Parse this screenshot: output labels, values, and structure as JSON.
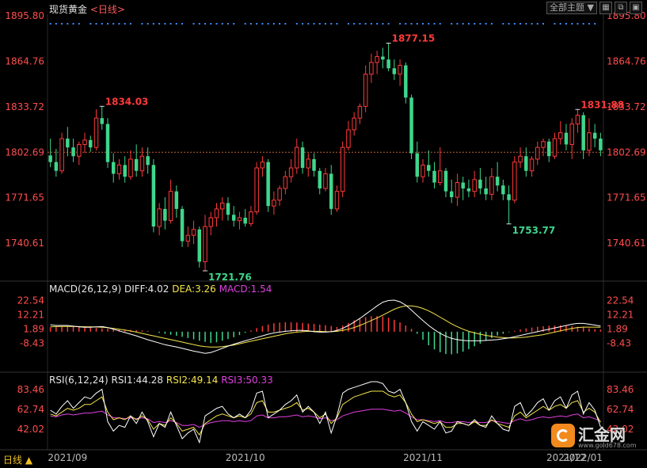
{
  "header": {
    "symbol": "现货黄金",
    "period_link": "<日线>",
    "toolbar_theme": "全部主题",
    "toolbar_arrow": "▼",
    "toolbar_icons": [
      "window-icon",
      "restore-icon",
      "maximize-icon"
    ]
  },
  "price_axis_labels": [
    "1895.80",
    "1864.76",
    "1833.72",
    "1802.69",
    "1771.65",
    "1740.61"
  ],
  "macd": {
    "title": "MACD(26,12,9)",
    "diff_label": "DIFF:4.02",
    "dea_label": "DEA:3.26",
    "macd_label": "MACD:1.54",
    "axis_labels": [
      "22.54",
      "12.21",
      "1.89",
      "-8.43"
    ]
  },
  "rsi": {
    "title": "RSI(6,12,24)",
    "rsi1_label": "RSI1:44.28",
    "rsi2_label": "RSI2:49.14",
    "rsi3_label": "RSI3:50.33",
    "axis_labels": [
      "83.46",
      "62.74",
      "42.02"
    ]
  },
  "date_labels": [
    "2021/09",
    "2021/10",
    "2021/11",
    "2021/12",
    "2022/01"
  ],
  "period_button": "日线 ▲",
  "watermark": {
    "name": "汇金网",
    "url": "www.gold678.com"
  },
  "colors": {
    "up": "#ff3a3a",
    "down": "#3fd68c",
    "price_axis": "#ff4d4d",
    "diff": "#ffffff",
    "dea": "#f5e64a",
    "macd_pos": "#ff3a3a",
    "macd_neg": "#3fd68c",
    "rsi1": "#ffffff",
    "rsi2": "#f5e64a",
    "rsi3": "#e040e0",
    "event_dots": "#3a8cff"
  },
  "chart_data": {
    "type": "candlestick",
    "title": "现货黄金 日线",
    "ylim": [
      1725,
      1895.8
    ],
    "reference_line": 1802.69,
    "annotations": [
      {
        "label": "1834.03",
        "type": "high"
      },
      {
        "label": "1721.76",
        "type": "low"
      },
      {
        "label": "1877.15",
        "type": "high"
      },
      {
        "label": "1753.77",
        "type": "low"
      },
      {
        "label": "1831.88",
        "type": "high"
      }
    ],
    "candles": [
      [
        1800.5,
        1812.0,
        1792.5,
        1796.0
      ],
      [
        1796.0,
        1805.0,
        1786.0,
        1790.0
      ],
      [
        1790.0,
        1816.0,
        1788.0,
        1812.0
      ],
      [
        1812.0,
        1820.0,
        1800.0,
        1806.0
      ],
      [
        1806.0,
        1812.0,
        1796.0,
        1800.0
      ],
      [
        1800.0,
        1810.0,
        1794.0,
        1808.0
      ],
      [
        1808.0,
        1816.0,
        1802.0,
        1811.0
      ],
      [
        1811.0,
        1814.0,
        1803.0,
        1806.0
      ],
      [
        1806.0,
        1832.0,
        1804.0,
        1826.0
      ],
      [
        1826.0,
        1834.03,
        1818.0,
        1822.0
      ],
      [
        1822.0,
        1826.0,
        1792.0,
        1796.0
      ],
      [
        1796.0,
        1802.0,
        1782.0,
        1788.0
      ],
      [
        1788.0,
        1798.0,
        1784.0,
        1794.0
      ],
      [
        1794.0,
        1800.0,
        1782.0,
        1786.0
      ],
      [
        1786.0,
        1804.0,
        1784.0,
        1798.0
      ],
      [
        1798.0,
        1808.0,
        1786.0,
        1790.0
      ],
      [
        1790.0,
        1806.0,
        1786.0,
        1800.0
      ],
      [
        1800.0,
        1806.0,
        1788.0,
        1794.0
      ],
      [
        1794.0,
        1798.0,
        1748.0,
        1752.0
      ],
      [
        1752.0,
        1768.0,
        1746.0,
        1764.0
      ],
      [
        1764.0,
        1772.0,
        1750.0,
        1756.0
      ],
      [
        1756.0,
        1784.0,
        1754.0,
        1776.0
      ],
      [
        1776.0,
        1780.0,
        1758.0,
        1764.0
      ],
      [
        1764.0,
        1766.0,
        1738.0,
        1742.0
      ],
      [
        1742.0,
        1752.0,
        1738.0,
        1746.0
      ],
      [
        1746.0,
        1756.0,
        1740.0,
        1750.0
      ],
      [
        1750.0,
        1752.0,
        1724.0,
        1728.0
      ],
      [
        1728.0,
        1760.0,
        1721.76,
        1752.0
      ],
      [
        1752.0,
        1762.0,
        1746.0,
        1758.0
      ],
      [
        1758.0,
        1768.0,
        1752.0,
        1764.0
      ],
      [
        1764.0,
        1772.0,
        1756.0,
        1768.0
      ],
      [
        1768.0,
        1772.0,
        1756.0,
        1760.0
      ],
      [
        1760.0,
        1766.0,
        1752.0,
        1756.0
      ],
      [
        1756.0,
        1762.0,
        1750.0,
        1758.0
      ],
      [
        1758.0,
        1764.0,
        1752.0,
        1754.0
      ],
      [
        1754.0,
        1766.0,
        1752.0,
        1762.0
      ],
      [
        1762.0,
        1796.0,
        1760.0,
        1792.0
      ],
      [
        1792.0,
        1800.0,
        1786.0,
        1796.0
      ],
      [
        1796.0,
        1798.0,
        1762.0,
        1766.0
      ],
      [
        1766.0,
        1776.0,
        1760.0,
        1770.0
      ],
      [
        1770.0,
        1780.0,
        1766.0,
        1778.0
      ],
      [
        1778.0,
        1790.0,
        1774.0,
        1786.0
      ],
      [
        1786.0,
        1798.0,
        1782.0,
        1792.0
      ],
      [
        1792.0,
        1812.0,
        1788.0,
        1806.0
      ],
      [
        1806.0,
        1810.0,
        1788.0,
        1792.0
      ],
      [
        1792.0,
        1802.0,
        1786.0,
        1798.0
      ],
      [
        1798.0,
        1802.0,
        1786.0,
        1790.0
      ],
      [
        1790.0,
        1792.0,
        1774.0,
        1778.0
      ],
      [
        1778.0,
        1792.0,
        1776.0,
        1788.0
      ],
      [
        1788.0,
        1794.0,
        1760.0,
        1764.0
      ],
      [
        1764.0,
        1780.0,
        1762.0,
        1776.0
      ],
      [
        1776.0,
        1810.0,
        1772.0,
        1806.0
      ],
      [
        1806.0,
        1824.0,
        1804.0,
        1818.0
      ],
      [
        1818.0,
        1830.0,
        1814.0,
        1826.0
      ],
      [
        1826.0,
        1836.0,
        1822.0,
        1834.0
      ],
      [
        1834.0,
        1862.0,
        1830.0,
        1856.0
      ],
      [
        1856.0,
        1870.0,
        1850.0,
        1864.0
      ],
      [
        1864.0,
        1872.0,
        1856.0,
        1868.0
      ],
      [
        1868.0,
        1874.0,
        1860.0,
        1866.0
      ],
      [
        1866.0,
        1877.15,
        1858.0,
        1860.0
      ],
      [
        1860.0,
        1866.0,
        1852.0,
        1856.0
      ],
      [
        1856.0,
        1866.0,
        1848.0,
        1862.0
      ],
      [
        1862.0,
        1864.0,
        1836.0,
        1840.0
      ],
      [
        1840.0,
        1842.0,
        1798.0,
        1802.0
      ],
      [
        1802.0,
        1810.0,
        1782.0,
        1786.0
      ],
      [
        1786.0,
        1798.0,
        1782.0,
        1794.0
      ],
      [
        1794.0,
        1804.0,
        1786.0,
        1790.0
      ],
      [
        1790.0,
        1796.0,
        1778.0,
        1782.0
      ],
      [
        1782.0,
        1806.0,
        1780.0,
        1790.0
      ],
      [
        1790.0,
        1792.0,
        1772.0,
        1776.0
      ],
      [
        1776.0,
        1784.0,
        1768.0,
        1772.0
      ],
      [
        1772.0,
        1788.0,
        1766.0,
        1782.0
      ],
      [
        1782.0,
        1786.0,
        1770.0,
        1778.0
      ],
      [
        1778.0,
        1784.0,
        1772.0,
        1776.0
      ],
      [
        1776.0,
        1790.0,
        1772.0,
        1784.0
      ],
      [
        1784.0,
        1792.0,
        1774.0,
        1778.0
      ],
      [
        1778.0,
        1786.0,
        1770.0,
        1774.0
      ],
      [
        1774.0,
        1792.0,
        1770.0,
        1786.0
      ],
      [
        1786.0,
        1796.0,
        1776.0,
        1780.0
      ],
      [
        1780.0,
        1784.0,
        1770.0,
        1774.0
      ],
      [
        1774.0,
        1780.0,
        1753.77,
        1770.0
      ],
      [
        1770.0,
        1800.0,
        1768.0,
        1796.0
      ],
      [
        1796.0,
        1806.0,
        1792.0,
        1800.0
      ],
      [
        1800.0,
        1806.0,
        1786.0,
        1790.0
      ],
      [
        1790.0,
        1800.0,
        1786.0,
        1798.0
      ],
      [
        1798.0,
        1810.0,
        1794.0,
        1806.0
      ],
      [
        1806.0,
        1812.0,
        1800.0,
        1810.0
      ],
      [
        1810.0,
        1812.0,
        1796.0,
        1800.0
      ],
      [
        1800.0,
        1816.0,
        1798.0,
        1812.0
      ],
      [
        1812.0,
        1824.0,
        1808.0,
        1816.0
      ],
      [
        1816.0,
        1822.0,
        1804.0,
        1808.0
      ],
      [
        1808.0,
        1826.0,
        1798.0,
        1822.0
      ],
      [
        1822.0,
        1831.88,
        1816.0,
        1828.0
      ],
      [
        1828.0,
        1830.0,
        1798.0,
        1804.0
      ],
      [
        1804.0,
        1826.0,
        1800.0,
        1816.0
      ],
      [
        1816.0,
        1822.0,
        1806.0,
        1812.0
      ],
      [
        1812.0,
        1816.0,
        1800.0,
        1804.0
      ]
    ],
    "macd_hist": [
      3.1,
      3.3,
      3.4,
      3.6,
      3.7,
      3.6,
      3.4,
      3.1,
      2.7,
      2.4,
      2.2,
      1.9,
      1.6,
      1.4,
      1.3,
      1.1,
      0.9,
      0.6,
      -0.1,
      -0.8,
      -1.5,
      -2.2,
      -2.9,
      -3.7,
      -4.6,
      -5.5,
      -6.5,
      -7.4,
      -8.2,
      -7.6,
      -6.5,
      -5.3,
      -4.0,
      -2.4,
      -0.8,
      0.9,
      2.6,
      4.1,
      5.2,
      6.1,
      6.6,
      6.9,
      6.9,
      6.6,
      6.3,
      5.9,
      5.6,
      5.1,
      4.7,
      4.1,
      3.4,
      4.4,
      6.3,
      8.2,
      9.4,
      10.5,
      11.2,
      11.3,
      11.0,
      10.1,
      8.6,
      6.7,
      4.5,
      2.1,
      -1.5,
      -5.8,
      -9.8,
      -12.8,
      -14.8,
      -16.1,
      -16.3,
      -15.7,
      -14.4,
      -12.6,
      -10.5,
      -8.6,
      -6.6,
      -4.6,
      -2.8,
      -1.5,
      -0.4,
      0.6,
      1.6,
      2.4,
      3.0,
      3.6,
      4.0,
      4.3,
      4.5,
      4.7,
      4.6,
      4.1,
      3.6,
      3.1,
      2.4,
      1.8,
      1.54
    ],
    "diff": [
      5,
      4.5,
      4.5,
      4.5,
      4,
      3.5,
      3.2,
      3.2,
      3.5,
      3.7,
      3.0,
      1.8,
      0.6,
      -0.6,
      -1.8,
      -3.0,
      -4.4,
      -5.8,
      -7.0,
      -8.2,
      -9.4,
      -10.2,
      -11.0,
      -12.0,
      -13.0,
      -14.0,
      -14.8,
      -15.6,
      -15.0,
      -13.6,
      -12.0,
      -10.4,
      -9.0,
      -7.8,
      -6.6,
      -5.4,
      -4.2,
      -3.0,
      -1.8,
      -0.9,
      -0.3,
      0.3,
      0.6,
      0.9,
      0.9,
      0.6,
      0.0,
      -0.3,
      -0.3,
      0.0,
      0.9,
      2.4,
      4.5,
      6.9,
      9.6,
      12.6,
      15.6,
      18.6,
      21.3,
      22.5,
      22.8,
      21.6,
      19.2,
      15.6,
      11.7,
      8.1,
      4.5,
      1.5,
      -1.2,
      -3.3,
      -4.8,
      -5.7,
      -6.3,
      -6.6,
      -6.6,
      -6.6,
      -6.3,
      -6.0,
      -5.7,
      -5.1,
      -4.5,
      -3.6,
      -2.7,
      -1.8,
      -0.9,
      0.0,
      0.9,
      1.8,
      2.7,
      3.6,
      4.5,
      5.4,
      6.0,
      6.0,
      5.4,
      4.8,
      4.02
    ],
    "dea": [
      3.5,
      3.7,
      3.8,
      3.8,
      3.8,
      3.7,
      3.6,
      3.5,
      3.4,
      3.2,
      2.9,
      2.4,
      1.8,
      1.2,
      0.5,
      -0.3,
      -1.2,
      -2.1,
      -3.0,
      -3.9,
      -4.8,
      -5.7,
      -6.6,
      -7.5,
      -8.4,
      -9.3,
      -10.2,
      -10.8,
      -11.1,
      -11.1,
      -10.8,
      -10.2,
      -9.6,
      -8.7,
      -7.8,
      -6.9,
      -6.0,
      -5.1,
      -4.2,
      -3.3,
      -2.4,
      -1.5,
      -0.9,
      -0.3,
      0.0,
      0.3,
      0.3,
      0.3,
      0.0,
      0.0,
      0.3,
      0.9,
      1.8,
      3.0,
      4.5,
      6.3,
      8.1,
      9.9,
      12.0,
      14.1,
      16.2,
      17.7,
      18.6,
      18.6,
      18.0,
      16.8,
      15.0,
      12.9,
      10.5,
      8.1,
      5.7,
      3.6,
      1.8,
      0.3,
      -0.9,
      -1.8,
      -2.7,
      -3.3,
      -3.9,
      -4.2,
      -4.5,
      -4.5,
      -4.2,
      -3.9,
      -3.3,
      -2.7,
      -2.1,
      -1.2,
      -0.3,
      0.6,
      1.5,
      2.4,
      3.0,
      3.3,
      3.3,
      3.3,
      3.26
    ],
    "rsi1": [
      62,
      58,
      66,
      72,
      64,
      70,
      76,
      74,
      80,
      84,
      50,
      40,
      46,
      44,
      56,
      48,
      60,
      50,
      34,
      48,
      44,
      60,
      46,
      32,
      38,
      42,
      28,
      56,
      60,
      64,
      66,
      58,
      54,
      58,
      54,
      62,
      80,
      82,
      54,
      58,
      62,
      68,
      72,
      78,
      60,
      66,
      60,
      48,
      60,
      38,
      56,
      80,
      84,
      86,
      88,
      90,
      92,
      92,
      90,
      82,
      80,
      84,
      70,
      50,
      40,
      50,
      46,
      42,
      50,
      38,
      40,
      50,
      48,
      46,
      52,
      46,
      44,
      56,
      48,
      42,
      40,
      66,
      70,
      56,
      62,
      70,
      74,
      62,
      72,
      76,
      64,
      78,
      82,
      58,
      70,
      62,
      44.28
    ],
    "rsi2": [
      58,
      56,
      60,
      64,
      62,
      64,
      68,
      68,
      72,
      76,
      60,
      52,
      54,
      52,
      56,
      52,
      56,
      52,
      42,
      48,
      46,
      54,
      48,
      40,
      42,
      44,
      36,
      48,
      52,
      56,
      58,
      56,
      54,
      56,
      54,
      58,
      70,
      72,
      60,
      60,
      62,
      64,
      66,
      70,
      62,
      64,
      60,
      54,
      58,
      48,
      54,
      68,
      72,
      76,
      78,
      80,
      82,
      82,
      82,
      78,
      76,
      78,
      70,
      58,
      50,
      52,
      50,
      48,
      50,
      44,
      44,
      48,
      48,
      46,
      50,
      46,
      46,
      52,
      48,
      46,
      44,
      56,
      60,
      54,
      58,
      62,
      66,
      62,
      66,
      68,
      64,
      70,
      72,
      60,
      64,
      60,
      49.14
    ],
    "rsi3": [
      56,
      55,
      57,
      58,
      57,
      58,
      59,
      59,
      60,
      61,
      57,
      54,
      54,
      53,
      54,
      53,
      54,
      53,
      49,
      50,
      49,
      51,
      49,
      46,
      46,
      47,
      44,
      47,
      49,
      50,
      51,
      51,
      50,
      51,
      50,
      51,
      56,
      57,
      54,
      54,
      55,
      55,
      56,
      57,
      55,
      56,
      55,
      53,
      54,
      51,
      52,
      56,
      58,
      60,
      61,
      62,
      63,
      63,
      63,
      62,
      61,
      62,
      59,
      55,
      52,
      52,
      51,
      50,
      51,
      49,
      49,
      50,
      50,
      49,
      50,
      49,
      49,
      51,
      50,
      49,
      48,
      51,
      53,
      51,
      52,
      54,
      55,
      54,
      55,
      56,
      55,
      57,
      58,
      54,
      55,
      53,
      50.33
    ]
  }
}
